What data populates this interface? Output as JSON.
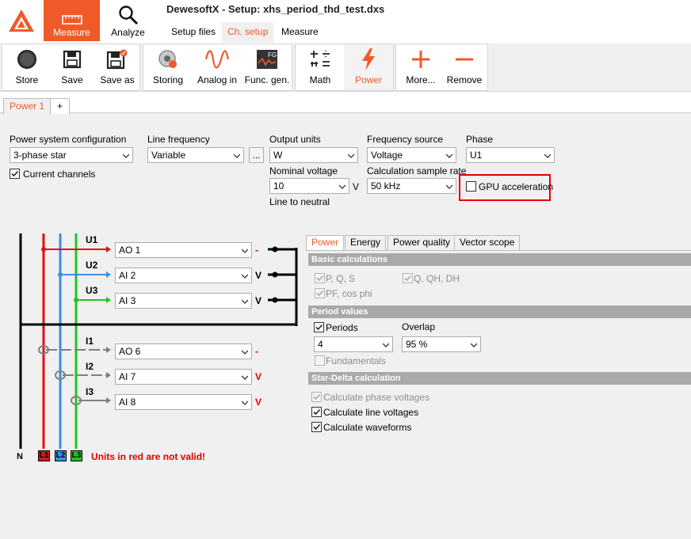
{
  "app": {
    "window_title": "DewesoftX - Setup: xhs_period_thd_test.dxs"
  },
  "modes": [
    {
      "label": "Measure"
    },
    {
      "label": "Analyze"
    }
  ],
  "nav_tabs": [
    {
      "label": "Setup files"
    },
    {
      "label": "Ch. setup"
    },
    {
      "label": "Measure"
    }
  ],
  "toolbar": {
    "file": [
      {
        "label": "Store",
        "icon": "record-icon"
      },
      {
        "label": "Save",
        "icon": "floppy-icon"
      },
      {
        "label": "Save as",
        "icon": "floppy-edit-icon"
      }
    ],
    "channels": [
      {
        "label": "Storing",
        "icon": "storing-icon"
      },
      {
        "label": "Analog in",
        "icon": "sine-wave-icon"
      },
      {
        "label": "Func. gen.",
        "icon": "function-generator-icon"
      }
    ],
    "math": [
      {
        "label": "Math",
        "icon": "math-operators-icon"
      },
      {
        "label": "Power",
        "icon": "lightning-icon"
      }
    ],
    "edit": [
      {
        "label": "More...",
        "icon": "plus-icon"
      },
      {
        "label": "Remove",
        "icon": "minus-icon"
      }
    ]
  },
  "module_tabs": [
    {
      "label": "Power 1"
    },
    {
      "label": "+"
    }
  ],
  "config": {
    "power_system": {
      "label": "Power system configuration",
      "value": "3-phase star"
    },
    "current_channels": {
      "label": "Current channels",
      "checked": true
    },
    "line_frequency": {
      "label": "Line frequency",
      "value": "Variable",
      "extra_button": "..."
    },
    "output_units": {
      "label": "Output units",
      "value": "W"
    },
    "nominal_voltage": {
      "label": "Nominal voltage",
      "value": "10",
      "unit": "V",
      "note": "Line to neutral"
    },
    "frequency_source": {
      "label": "Frequency source",
      "value": "Voltage"
    },
    "sample_rate": {
      "label": "Calculation sample rate",
      "value": "50 kHz"
    },
    "phase": {
      "label": "Phase",
      "value": "U1"
    },
    "gpu": {
      "label": "GPU acceleration",
      "checked": false
    }
  },
  "wiring": {
    "voltages": [
      {
        "name": "U1",
        "channel": "AO 1",
        "unit": "-",
        "unit_color": "#e00000"
      },
      {
        "name": "U2",
        "channel": "AI 2",
        "unit": "V",
        "unit_color": "#000000"
      },
      {
        "name": "U3",
        "channel": "AI 3",
        "unit": "V",
        "unit_color": "#000000"
      }
    ],
    "currents": [
      {
        "name": "I1",
        "channel": "AO 6",
        "unit": "-",
        "unit_color": "#e00000"
      },
      {
        "name": "I2",
        "channel": "AI 7",
        "unit": "V",
        "unit_color": "#e00000"
      },
      {
        "name": "I3",
        "channel": "AI 8",
        "unit": "V",
        "unit_color": "#e00000"
      }
    ],
    "legend": {
      "n": "N",
      "l1": "L1",
      "l2": "L2",
      "l3": "L3"
    },
    "warning": "Units in red are not valid!",
    "colors": {
      "l1": "#e01010",
      "l2": "#3a8ee6",
      "l3": "#22c322",
      "n": "#000000"
    }
  },
  "panel": {
    "tabs": [
      {
        "label": "Power"
      },
      {
        "label": "Energy"
      },
      {
        "label": "Power quality"
      },
      {
        "label": "Vector scope"
      }
    ],
    "basic": {
      "header": "Basic calculations",
      "pq": "P, Q, S",
      "qqh": "Q, QH, DH",
      "pf": "PF, cos phi"
    },
    "period": {
      "header": "Period values",
      "periods_label": "Periods",
      "overlap_label": "Overlap",
      "periods_value": "4",
      "overlap_value": "95 %",
      "fundamentals": "Fundamentals"
    },
    "star": {
      "header": "Star-Delta calculation",
      "phase_voltages": "Calculate phase voltages",
      "line_voltages": "Calculate line voltages",
      "waveforms": "Calculate waveforms"
    }
  },
  "colors": {
    "accent": "#f05a28",
    "highlight": "#e00000"
  }
}
